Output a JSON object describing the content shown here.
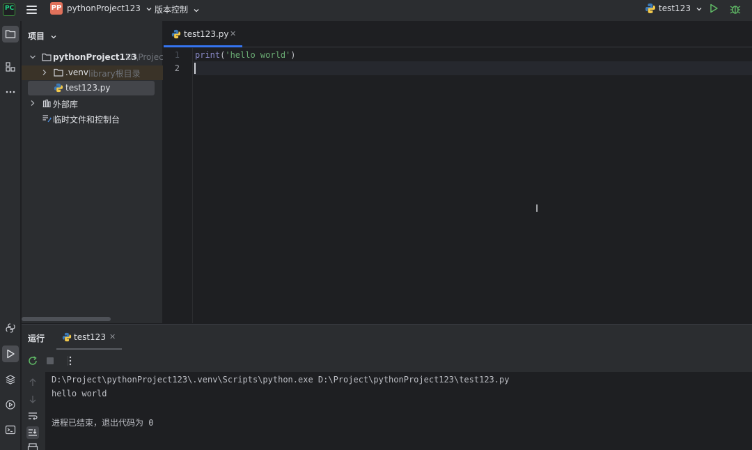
{
  "titlebar": {
    "project_badge": "PP",
    "project_name": "pythonProject123",
    "vcs_label": "版本控制",
    "run_config": "test123"
  },
  "project_panel": {
    "title": "项目",
    "tree": [
      {
        "label": "pythonProject123",
        "hint": "D:\\Project",
        "expanded": true
      },
      {
        "label": ".venv",
        "hint": "library根目录",
        "expanded": false
      },
      {
        "label": "test123.py",
        "hint": ""
      },
      {
        "label": "外部库",
        "hint": "",
        "expanded": false
      },
      {
        "label": "临时文件和控制台",
        "hint": ""
      }
    ]
  },
  "editor": {
    "tab_label": "test123.py",
    "lines": [
      {
        "number": "1",
        "code": "print('hello world')"
      },
      {
        "number": "2",
        "code": ""
      }
    ],
    "ibeam": "I"
  },
  "run_panel": {
    "title": "运行",
    "tab_label": "test123",
    "console": [
      "D:\\Project\\pythonProject123\\.venv\\Scripts\\python.exe D:\\Project\\pythonProject123\\test123.py",
      "hello world",
      "",
      "进程已结束，退出代码为 0"
    ]
  },
  "colors": {
    "accent": "#3574f0",
    "run_green": "#5fb865",
    "project_badge": "#e0715b",
    "panel_bg": "#2b2d30",
    "editor_bg": "#1e1f22"
  },
  "icons": {
    "titlebar": [
      "pycharm-logo-icon",
      "hamburger-menu-icon",
      "chevron-down-icon",
      "python-icon",
      "run-icon",
      "debug-icon"
    ],
    "toolstrip": [
      "project-folder-icon",
      "structure-icon",
      "more-icon",
      "python-packages-icon",
      "run-icon",
      "layers-icon",
      "services-icon",
      "terminal-icon"
    ],
    "run_toolbar": [
      "rerun-icon",
      "stop-icon",
      "more-vertical-icon"
    ],
    "run_side": [
      "arrow-up-icon",
      "arrow-down-icon",
      "soft-wrap-icon",
      "scroll-to-end-icon",
      "print-icon"
    ]
  }
}
